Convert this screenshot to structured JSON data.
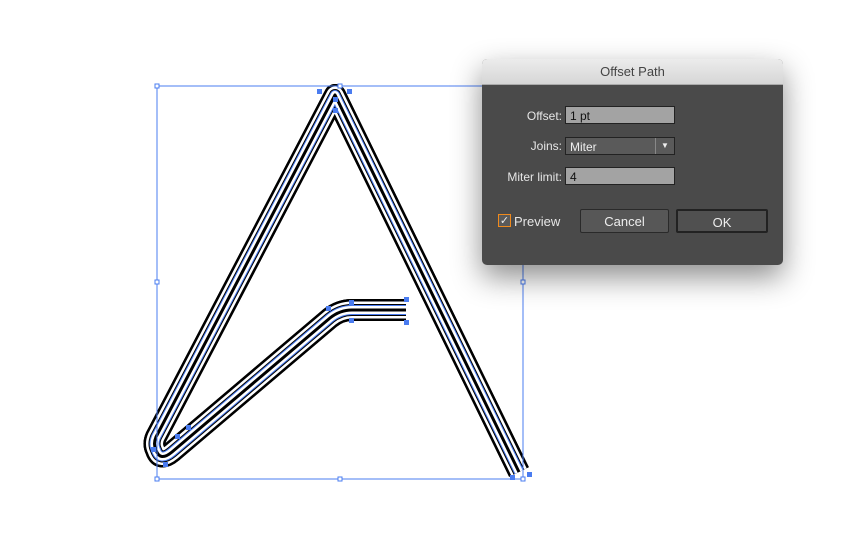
{
  "dialog": {
    "title": "Offset Path",
    "offset_label": "Offset:",
    "offset_value": "1 pt",
    "joins_label": "Joins:",
    "joins_value": "Miter",
    "miter_label": "Miter limit:",
    "miter_value": "4",
    "preview_label": "Preview",
    "preview_checked": true,
    "cancel": "Cancel",
    "ok": "OK"
  },
  "colors": {
    "selection": "#4a7cf0",
    "dialog_bg": "#4a4a4a",
    "checkbox_accent": "#f08a1c"
  }
}
